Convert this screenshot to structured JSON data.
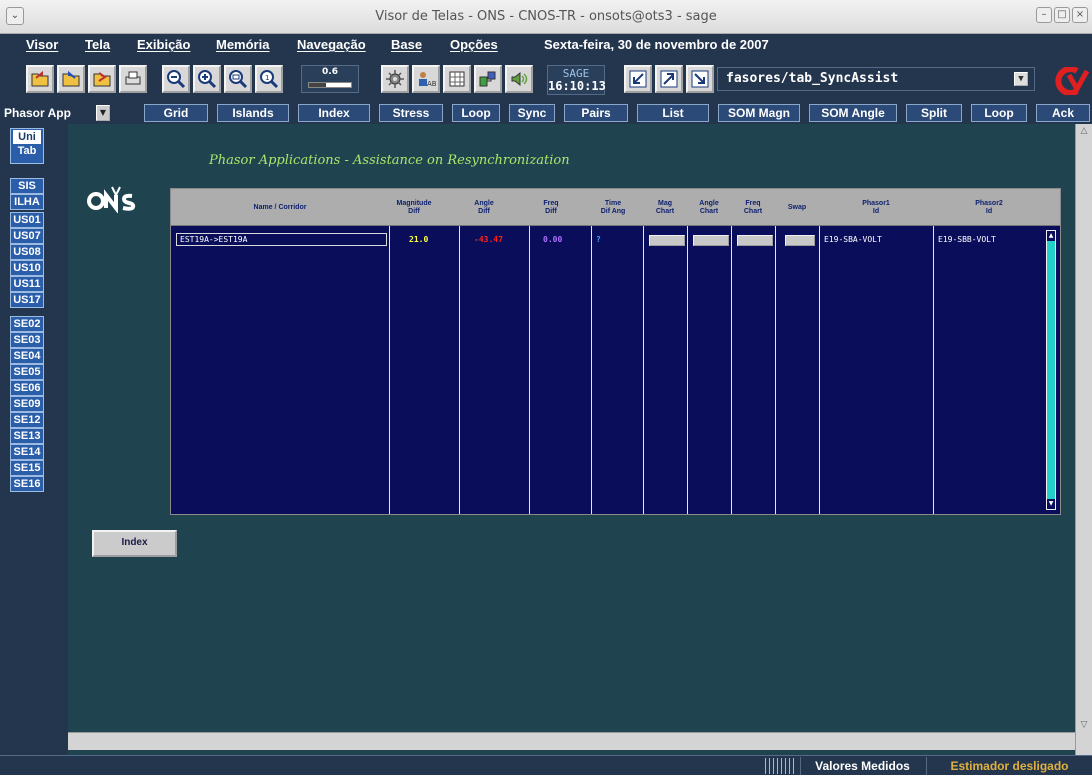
{
  "window": {
    "title": "Visor de Telas - ONS - CNOS-TR  - onsots@ots3 - sage"
  },
  "menu": {
    "items": [
      "Visor",
      "Tela",
      "Exibição",
      "Memória",
      "Navegação",
      "Base",
      "Opções"
    ],
    "date": "Sexta-feira, 30 de novembro de 2007"
  },
  "toolbar": {
    "zoom_value": "0.6",
    "zoom_level_fraction": 0.4,
    "clock_label": "SAGE",
    "clock_time": "16:10:13",
    "display_path": "fasores/tab_SyncAssist"
  },
  "tabbar": {
    "app_selector": "Phasor App",
    "tabs": [
      "Grid",
      "Islands",
      "Index",
      "Stress",
      "Loop",
      "Sync",
      "Pairs",
      "List",
      "SOM Magn",
      "SOM Angle",
      "Split",
      "Loop",
      "Ack"
    ]
  },
  "sidebar": {
    "top": [
      "Uni",
      "Tab"
    ],
    "items": [
      "SIS",
      "ILHA",
      "US01",
      "US07",
      "US08",
      "US10",
      "US11",
      "US17",
      "SE02",
      "SE03",
      "SE04",
      "SE05",
      "SE06",
      "SE09",
      "SE12",
      "SE13",
      "SE14",
      "SE15",
      "SE16"
    ]
  },
  "page": {
    "logo": "ONS",
    "title": "Phasor Applications - Assistance on Resynchronization",
    "index_button": "Index"
  },
  "table": {
    "headers": {
      "name": "Name / Corridor",
      "mag_diff": [
        "Magnitude",
        "Diff"
      ],
      "angle_diff": [
        "Angle",
        "Diff"
      ],
      "freq_diff": [
        "Freq",
        "Diff"
      ],
      "time_dif": [
        "Time",
        "Dif Ang"
      ],
      "mag_chart": [
        "Mag",
        "Chart"
      ],
      "angle_chart": [
        "Angle",
        "Chart"
      ],
      "freq_chart": [
        "Freq",
        "Chart"
      ],
      "swap": "Swap",
      "phasor1": [
        "Phasor1",
        "Id"
      ],
      "phasor2": [
        "Phasor2",
        "Id"
      ]
    },
    "rows": [
      {
        "name": "EST19A->EST19A",
        "mag_diff": "21.0",
        "angle_diff": "-43.47",
        "freq_diff": "0.00",
        "time_dif": "?",
        "phasor1": "E19-SBA-VOLT",
        "phasor2": "E19-SBB-VOLT"
      }
    ]
  },
  "status": {
    "measured": "Valores Medidos",
    "estimator": "Estimador desligado"
  },
  "colors": {
    "mag_value": "#ffff40",
    "angle_value": "#ff2020",
    "freq_value": "#b070ff",
    "time_value": "#40a0ff"
  }
}
